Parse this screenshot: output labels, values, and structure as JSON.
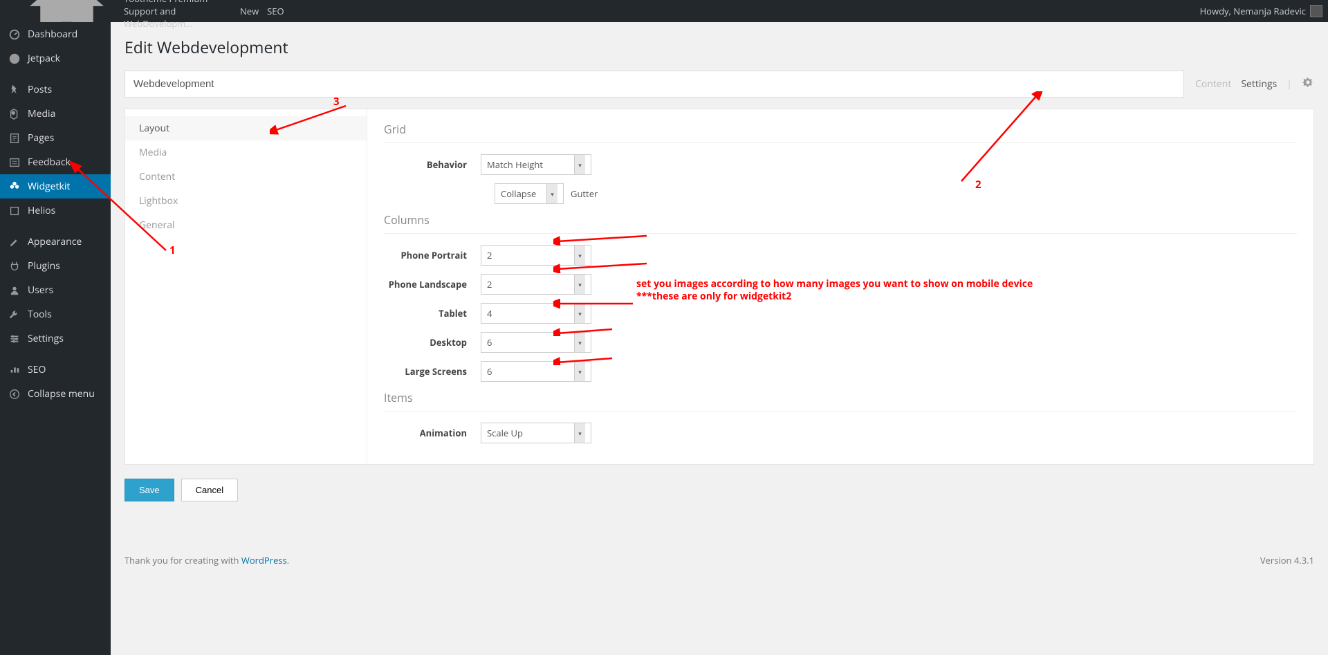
{
  "adminbar": {
    "site_name": "Yootheme Premium Support and WebDovelopm...",
    "new_label": "New",
    "seo_label": "SEO",
    "howdy": "Howdy, Nemanja Radevic"
  },
  "sidebar": {
    "items": [
      {
        "label": "Dashboard"
      },
      {
        "label": "Jetpack"
      },
      {
        "label": "Posts"
      },
      {
        "label": "Media"
      },
      {
        "label": "Pages"
      },
      {
        "label": "Feedback"
      },
      {
        "label": "Widgetkit",
        "active": true
      },
      {
        "label": "Helios"
      },
      {
        "label": "Appearance"
      },
      {
        "label": "Plugins"
      },
      {
        "label": "Users"
      },
      {
        "label": "Tools"
      },
      {
        "label": "Settings"
      },
      {
        "label": "SEO"
      },
      {
        "label": "Collapse menu"
      }
    ]
  },
  "page": {
    "title": "Edit Webdevelopment",
    "name_value": "Webdevelopment",
    "tab_content": "Content",
    "tab_settings": "Settings"
  },
  "panel_nav": {
    "items": [
      {
        "label": "Layout",
        "active": true
      },
      {
        "label": "Media"
      },
      {
        "label": "Content"
      },
      {
        "label": "Lightbox"
      },
      {
        "label": "General"
      }
    ]
  },
  "grid": {
    "title": "Grid",
    "behavior_label": "Behavior",
    "behavior_value": "Match Height",
    "gutter_value": "Collapse",
    "gutter_label": "Gutter"
  },
  "columns": {
    "title": "Columns",
    "phone_portrait_label": "Phone Portrait",
    "phone_portrait_value": "2",
    "phone_landscape_label": "Phone Landscape",
    "phone_landscape_value": "2",
    "tablet_label": "Tablet",
    "tablet_value": "4",
    "desktop_label": "Desktop",
    "desktop_value": "6",
    "large_label": "Large Screens",
    "large_value": "6"
  },
  "items": {
    "title": "Items",
    "animation_label": "Animation",
    "animation_value": "Scale Up"
  },
  "buttons": {
    "save": "Save",
    "cancel": "Cancel"
  },
  "footer": {
    "thanks_prefix": "Thank you for creating with ",
    "wp_link": "WordPress",
    "version": "Version 4.3.1"
  },
  "annotations": {
    "n1": "1",
    "n2": "2",
    "n3": "3",
    "note": "set you images according to how many images you want to show on mobile device\n***these are only for widgetkit2"
  }
}
